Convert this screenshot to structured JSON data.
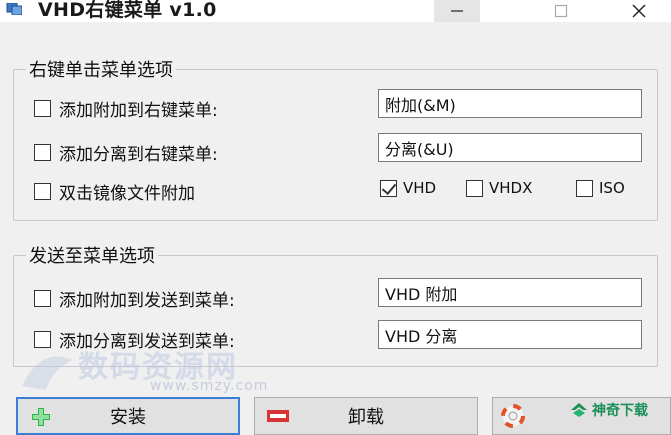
{
  "window": {
    "title": "VHD右键菜单 v1.0",
    "controls": {
      "minimize": "—",
      "maximize": "☐",
      "close": "✕"
    }
  },
  "context_menu_group": {
    "legend": "右键单击菜单选项",
    "attach_option": {
      "label": "添加附加到右键菜单:",
      "checked": false,
      "value": "附加(&M)"
    },
    "detach_option": {
      "label": "添加分离到右键菜单:",
      "checked": false,
      "value": "分离(&U)"
    },
    "double_click_option": {
      "label": "双击镜像文件附加",
      "checked": false
    },
    "file_types": [
      {
        "label": "VHD",
        "checked": true
      },
      {
        "label": "VHDX",
        "checked": false
      },
      {
        "label": "ISO",
        "checked": false
      }
    ]
  },
  "sendto_group": {
    "legend": "发送至菜单选项",
    "attach_option": {
      "label": "添加附加到发送到菜单:",
      "checked": false,
      "value": "VHD 附加"
    },
    "detach_option": {
      "label": "添加分离到发送到菜单:",
      "checked": false,
      "value": "VHD 分离"
    }
  },
  "buttons": {
    "install": "安装",
    "uninstall": "卸载",
    "about_icon": "lifebuoy-icon"
  },
  "watermark": {
    "text": "数码资源网",
    "url": "www.smzy.com",
    "brand": "神奇下载"
  },
  "colors": {
    "install_icon": "#2db34a",
    "uninstall_icon": "#d93434",
    "focus_border": "#3c7fd6",
    "brand": "#1a8f5a"
  }
}
